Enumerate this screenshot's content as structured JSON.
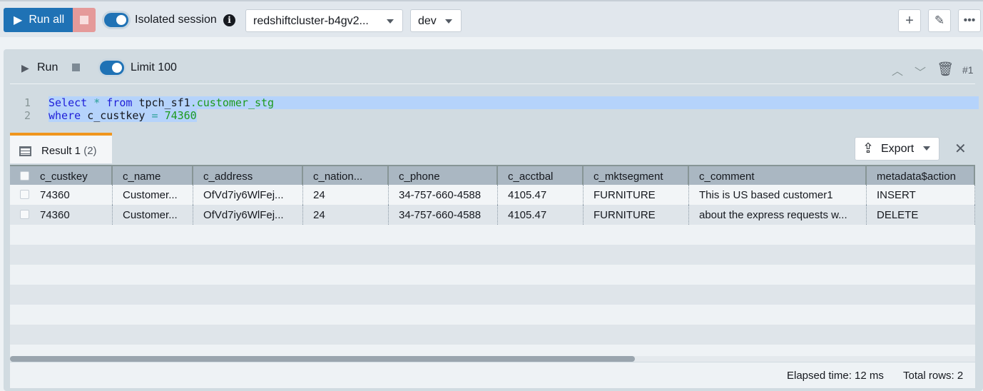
{
  "toolbar": {
    "run_all": "Run all",
    "isolated_session": "Isolated session",
    "cluster": "redshiftcluster-b4gv2...",
    "database": "dev"
  },
  "editor": {
    "run": "Run",
    "limit": "Limit 100",
    "cell_number": "#1",
    "lines": [
      {
        "n": "1",
        "kw1": "Select",
        "op": "*",
        "kw2": "from",
        "schema": "tpch_sf1",
        "table": ".customer_stg"
      },
      {
        "n": "2",
        "kw": "where",
        "col": "c_custkey",
        "op": "=",
        "val": "74360"
      }
    ]
  },
  "result": {
    "tab_label": "Result 1",
    "count": "(2)",
    "export": "Export",
    "columns": [
      "c_custkey",
      "c_name",
      "c_address",
      "c_nation...",
      "c_phone",
      "c_acctbal",
      "c_mktsegment",
      "c_comment",
      "metadata$action"
    ],
    "rows": [
      [
        "74360",
        "Customer...",
        "OfVd7iy6WlFej...",
        "24",
        "34-757-660-4588",
        "4105.47",
        "FURNITURE",
        "This is US based customer1",
        "INSERT"
      ],
      [
        "74360",
        "Customer...",
        "OfVd7iy6WlFej...",
        "24",
        "34-757-660-4588",
        "4105.47",
        "FURNITURE",
        "about the express requests w...",
        "DELETE"
      ]
    ],
    "elapsed": "Elapsed time: 12 ms",
    "total": "Total rows: 2"
  }
}
